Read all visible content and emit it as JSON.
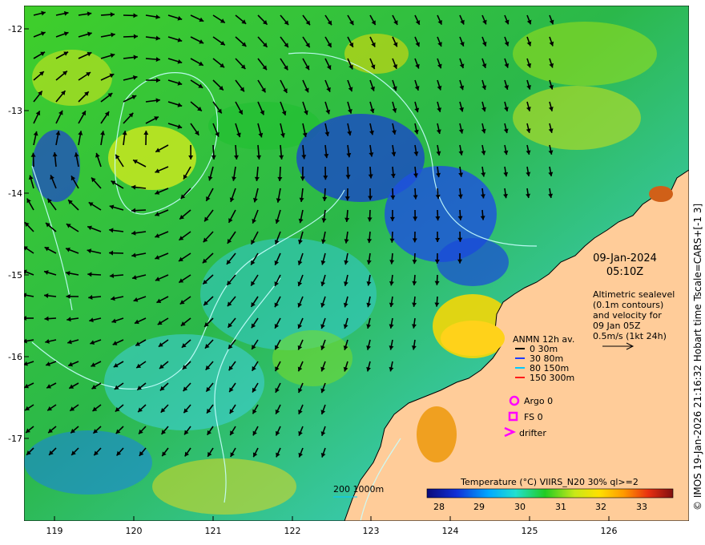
{
  "map": {
    "date": "09-Jan-2024",
    "time": "05:10Z",
    "altimetry_note": [
      "Altimetric sealevel",
      "(0.1m contours)",
      "and velocity for",
      "09 Jan 05Z",
      "0.5m/s (1kt 24h)"
    ],
    "credit": "© IMOS 19-Jan-2026 21:16:32 Hobart time Tscale=CARS+[-1 3]"
  },
  "axes": {
    "lon_ticks": [
      "119",
      "120",
      "121",
      "122",
      "123",
      "124",
      "125",
      "126"
    ],
    "lat_ticks": [
      "-12",
      "-13",
      "-14",
      "-15",
      "-16",
      "-17"
    ]
  },
  "legend": {
    "title": "ANMN 12h av.",
    "depths": [
      {
        "label": "0 30m",
        "color": "#000000"
      },
      {
        "label": "30 80m",
        "color": "#1f3bff"
      },
      {
        "label": "80 150m",
        "color": "#00c8ff"
      },
      {
        "label": "150 300m",
        "color": "#ff1a1a"
      }
    ],
    "platforms": [
      {
        "label": "Argo 0",
        "symbol": "circle"
      },
      {
        "label": "FS 0",
        "symbol": "square"
      },
      {
        "label": "drifter",
        "symbol": "chevron"
      }
    ],
    "magenta": "#ff00ff",
    "isobath_label": "200  1000m"
  },
  "colorbar": {
    "title": "Temperature (°C) VIIRS_N20 30% ql>=2",
    "ticks": [
      "28",
      "29",
      "30",
      "31",
      "32",
      "33"
    ]
  }
}
